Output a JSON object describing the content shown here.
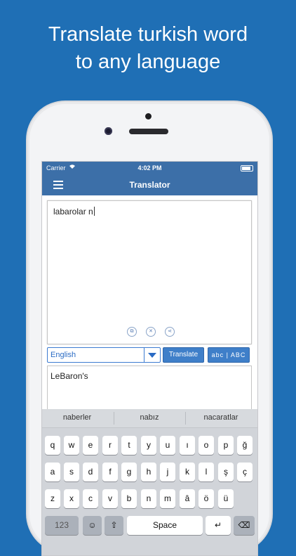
{
  "headline": {
    "line1": "Translate turkish word",
    "line2": "to any language"
  },
  "status": {
    "carrier": "Carrier",
    "time": "4:02 PM"
  },
  "nav": {
    "title": "Translator"
  },
  "input": {
    "text": "labarolar n"
  },
  "controls": {
    "language": "English",
    "translate_label": "Translate",
    "abc_label": "abc | ABC"
  },
  "output": {
    "text": "LeBaron's"
  },
  "suggestions": [
    "naberler",
    "nabız",
    "nacaratlar"
  ],
  "keys": {
    "row1": [
      "q",
      "w",
      "e",
      "r",
      "t",
      "y",
      "u",
      "ı",
      "o",
      "p",
      "ğ"
    ],
    "row2": [
      "a",
      "s",
      "d",
      "f",
      "g",
      "h",
      "j",
      "k",
      "l",
      "ş",
      "ç"
    ],
    "row3": [
      "z",
      "x",
      "c",
      "v",
      "b",
      "n",
      "m",
      "â",
      "ö",
      "ü"
    ],
    "num": "123",
    "space": "Space"
  },
  "icons": {
    "menu": "hamburger-icon",
    "copy": "copy-icon",
    "clear": "close-icon",
    "share": "share-icon",
    "emoji": "emoji-icon",
    "globe": "globe-icon",
    "return": "return-icon",
    "backspace": "backspace-icon"
  },
  "colors": {
    "background": "#1f6fb5",
    "bar": "#3c6fa8",
    "button": "#3f7fc9"
  }
}
